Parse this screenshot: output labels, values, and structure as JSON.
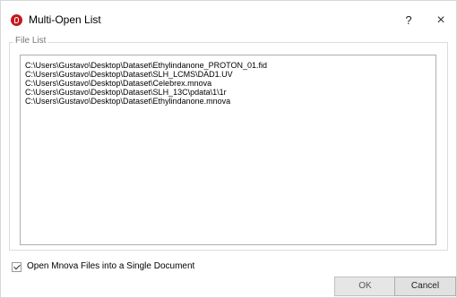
{
  "window": {
    "title": "Multi-Open List",
    "help_label": "?",
    "close_label": "×"
  },
  "group": {
    "label": "File List"
  },
  "files": [
    "C:\\Users\\Gustavo\\Desktop\\Dataset\\Ethylindanone_PROTON_01.fid",
    "C:\\Users\\Gustavo\\Desktop\\Dataset\\SLH_LCMS\\DAD1.UV",
    "C:\\Users\\Gustavo\\Desktop\\Dataset\\Celebrex.mnova",
    "C:\\Users\\Gustavo\\Desktop\\Dataset\\SLH_13C\\pdata\\1\\1r",
    "C:\\Users\\Gustavo\\Desktop\\Dataset\\Ethylindanone.mnova"
  ],
  "options": {
    "single_document_label": "Open Mnova Files into a Single Document",
    "single_document_checked": true
  },
  "buttons": {
    "ok": "OK",
    "cancel": "Cancel"
  },
  "colors": {
    "app_icon": "#c41a1e"
  }
}
